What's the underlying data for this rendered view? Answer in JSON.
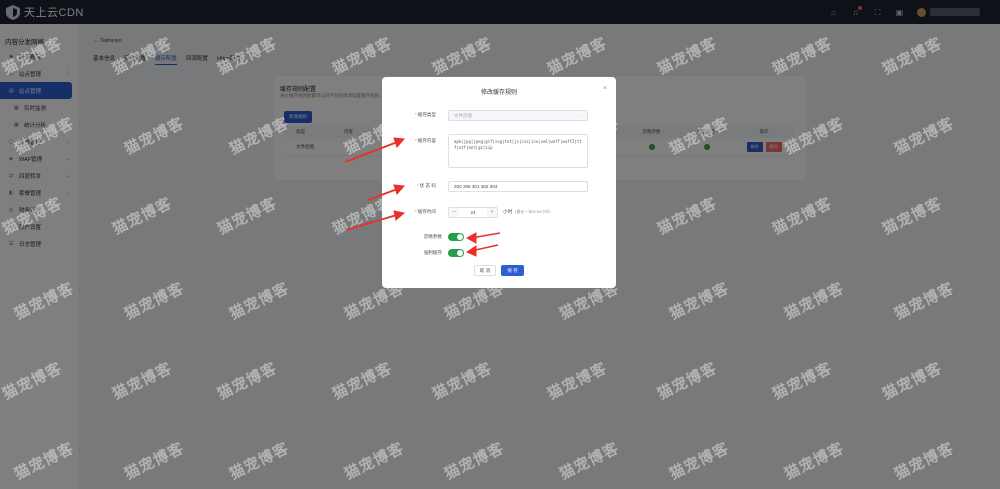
{
  "app": {
    "logo_text": "天上云CDN"
  },
  "topbar": {
    "icons": [
      "home-icon",
      "bell-icon",
      "fullscreen-icon",
      "layout-icon"
    ]
  },
  "sidebar": {
    "title": "内容分发网络",
    "items": [
      {
        "label": "服务概况",
        "icon": "dashboard-icon",
        "level": 1
      },
      {
        "label": "站点管理",
        "icon": "site-icon",
        "level": 1,
        "expandable": true
      },
      {
        "label": "站点管理",
        "icon": "list-icon",
        "level": 2,
        "active": true
      },
      {
        "label": "实时监测",
        "icon": "grid-icon",
        "level": 2
      },
      {
        "label": "统计分析",
        "icon": "grid-icon",
        "level": 2
      },
      {
        "label": "证书管理",
        "icon": "cert-icon",
        "level": 1,
        "expandable": true
      },
      {
        "label": "WAF管理",
        "icon": "shield-icon",
        "level": 1,
        "expandable": true
      },
      {
        "label": "四层转发",
        "icon": "forward-icon",
        "level": 1,
        "expandable": true
      },
      {
        "label": "套餐管理",
        "icon": "package-icon",
        "level": 1,
        "expandable": true
      },
      {
        "label": "财务管理",
        "icon": "finance-icon",
        "level": 1
      },
      {
        "label": "账户设置",
        "icon": "user-icon",
        "level": 1
      },
      {
        "label": "日志管理",
        "icon": "log-icon",
        "level": 1
      }
    ]
  },
  "page": {
    "breadcrumb": "Taimeiyo",
    "tabs": [
      "基本信息",
      "安全配置",
      "缓存配置",
      "回源配置",
      "Https配置"
    ],
    "active_tab": 2,
    "card_title": "缓存规则配置",
    "card_desc": "通过缓存规则配置可以对不同的资源设置缓存规则，以提高资源的命中率",
    "add_button": "新增规则",
    "table": {
      "headers": [
        "类型",
        "内容",
        "忽略参数",
        "强制缓存",
        "操作"
      ],
      "rows": [
        {
          "type": "文件后缀",
          "content": "",
          "ignore_args": true,
          "force_cache": true,
          "edit": "修改",
          "delete": "删除"
        }
      ]
    }
  },
  "modal": {
    "title": "修改缓存规则",
    "close": "×",
    "fields": {
      "cache_type": {
        "label": "缓存类型",
        "required": true,
        "value": "文件后缀"
      },
      "cache_content": {
        "label": "缓存内容",
        "required": true,
        "value": "apk|jpg|jpeg|gif|svg|txt|js|css|ico|xml|woff|woff2|ttf|otf|eot|gz|zip"
      },
      "status_code": {
        "label": "状 态 码",
        "required": true,
        "value": "200 206 301 302 304"
      },
      "cache_time": {
        "label": "缓存时间",
        "required": true,
        "value": "24",
        "unit": "小时",
        "hint": "(最长一年8760小时)",
        "minus": "－",
        "plus": "+"
      },
      "ignore_args": {
        "label": "忽略参数",
        "enabled": true
      },
      "force_cache": {
        "label": "强制缓存",
        "enabled": true
      }
    },
    "cancel_label": "取 消",
    "save_label": "保 存"
  },
  "watermark": "猫宠博客",
  "colors": {
    "primary": "#2d5fd3",
    "success": "#22a14a",
    "danger": "#f56c6c",
    "annotation_arrow": "#e8312a",
    "topbar": "#1c2330"
  }
}
